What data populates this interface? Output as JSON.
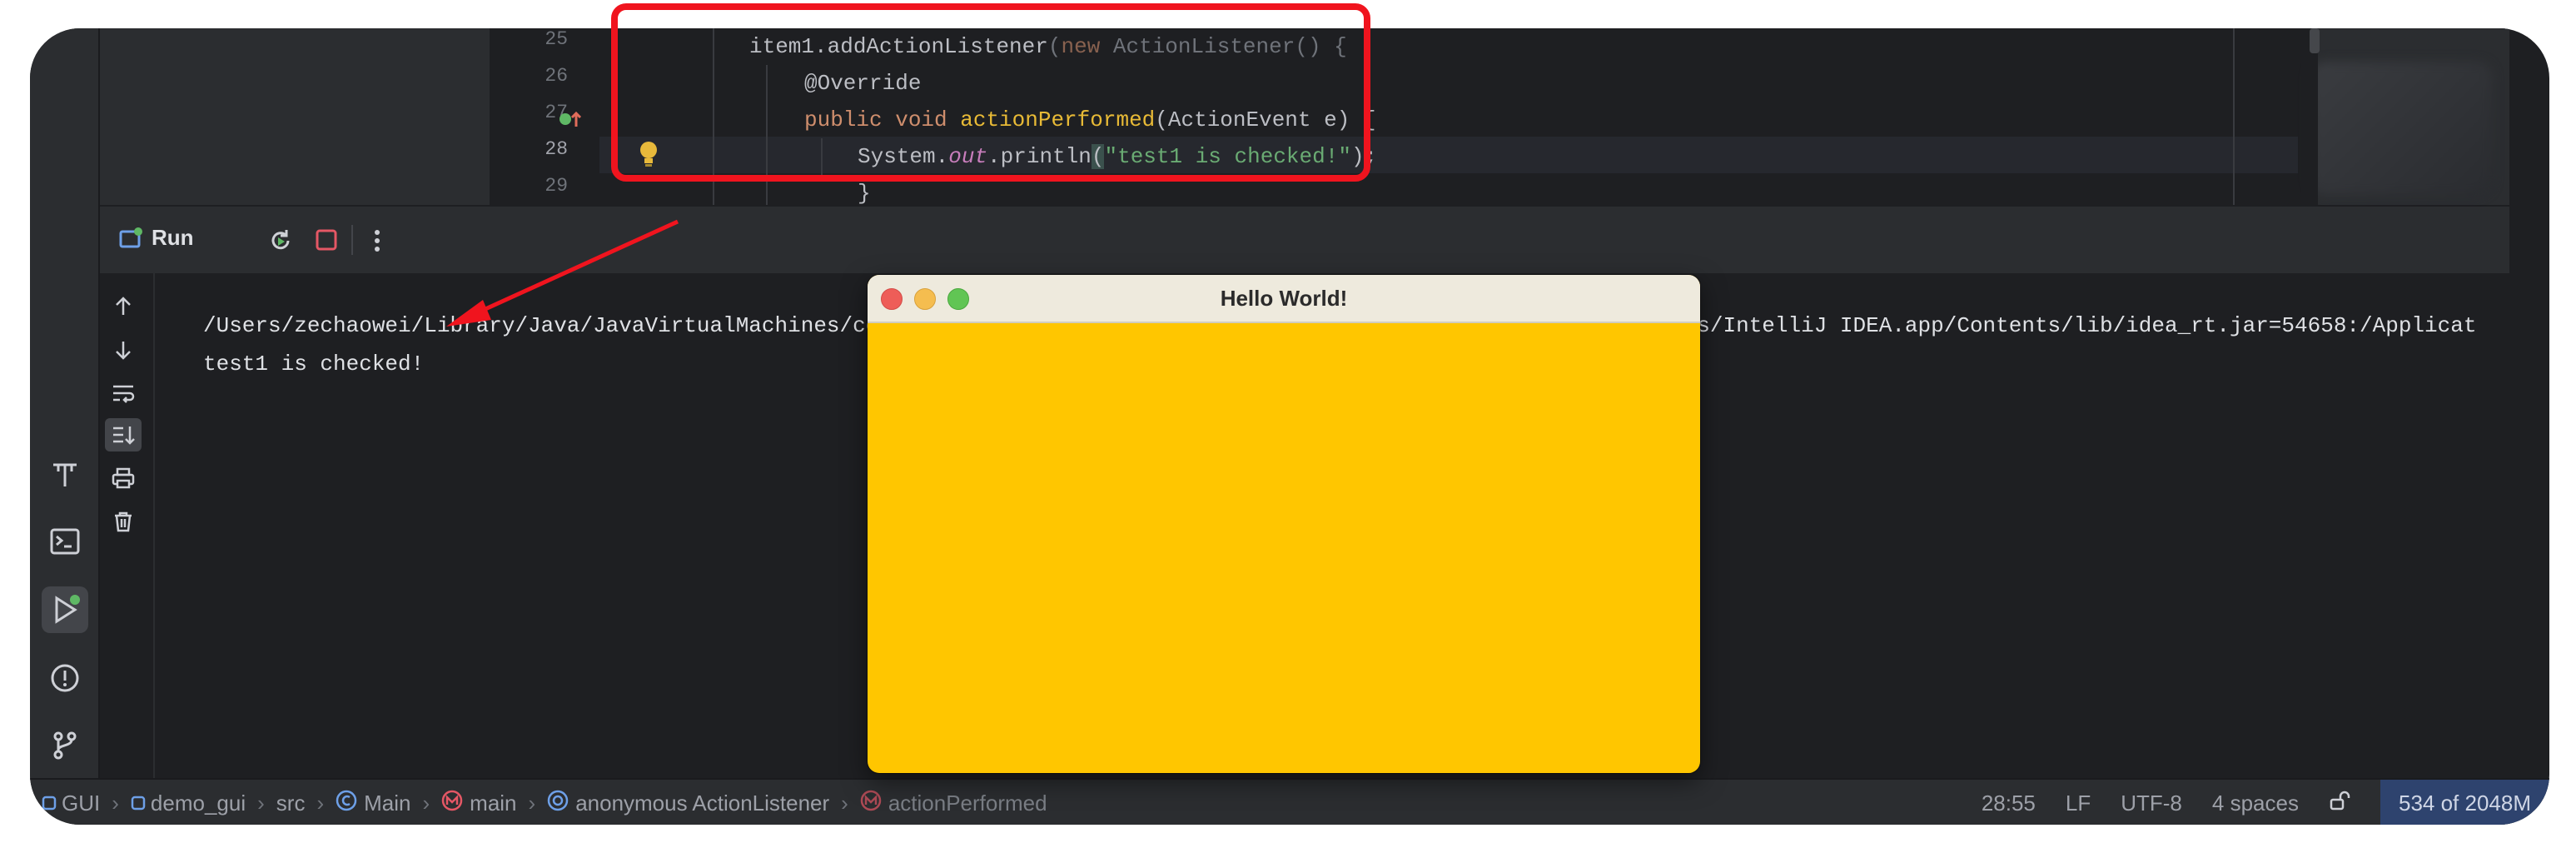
{
  "editor": {
    "line_numbers": [
      "25",
      "26",
      "27",
      "28",
      "29"
    ],
    "code": {
      "l25": {
        "obj": "item1",
        "dot1": ".",
        "method": "addActionListener",
        "paren": "(",
        "kw": "new",
        "type": " ActionListener",
        "rest": "() {"
      },
      "l26": {
        "annotation": "@Override"
      },
      "l27": {
        "kw": "public void ",
        "fn": "actionPerformed",
        "rest": "(ActionEvent e) {"
      },
      "l28": {
        "cls": "System",
        "dot": ".",
        "field": "out",
        "dot2": ".",
        "method": "println",
        "open": "(",
        "str": "\"test1 is checked!\"",
        "close": ");"
      },
      "l29": {
        "brace": "}"
      }
    }
  },
  "run_panel": {
    "title": "Run",
    "console_lines": [
      "/Users/zechaowei/Library/Java/JavaVirtualMachines/corretto-1.8.0_392/Contents/Home/bin/java -javaagent:/Applications/IntelliJ IDEA.app/Contents/lib/idea_rt.jar=54658:/Applicat",
      "test1 is checked!"
    ]
  },
  "window": {
    "title": "Hello World!",
    "background": "#ffc600"
  },
  "status_bar": {
    "breadcrumbs": [
      "GUI",
      "demo_gui",
      "src",
      "Main",
      "main",
      "anonymous ActionListener",
      "actionPerformed"
    ],
    "position": "28:55",
    "line_ending": "LF",
    "encoding": "UTF-8",
    "indent": "4 spaces",
    "memory": "534 of 2048M"
  },
  "colors": {
    "annotation_box": "#f0141e",
    "arrow": "#f0141e"
  },
  "icons": {
    "tool_strip": [
      "structure-icon",
      "terminal-icon",
      "run-icon",
      "problems-icon",
      "git-icon"
    ],
    "run_tools": [
      "up-arrow-icon",
      "down-arrow-icon",
      "soft-wrap-icon",
      "scroll-to-end-icon",
      "print-icon",
      "trash-icon"
    ]
  }
}
